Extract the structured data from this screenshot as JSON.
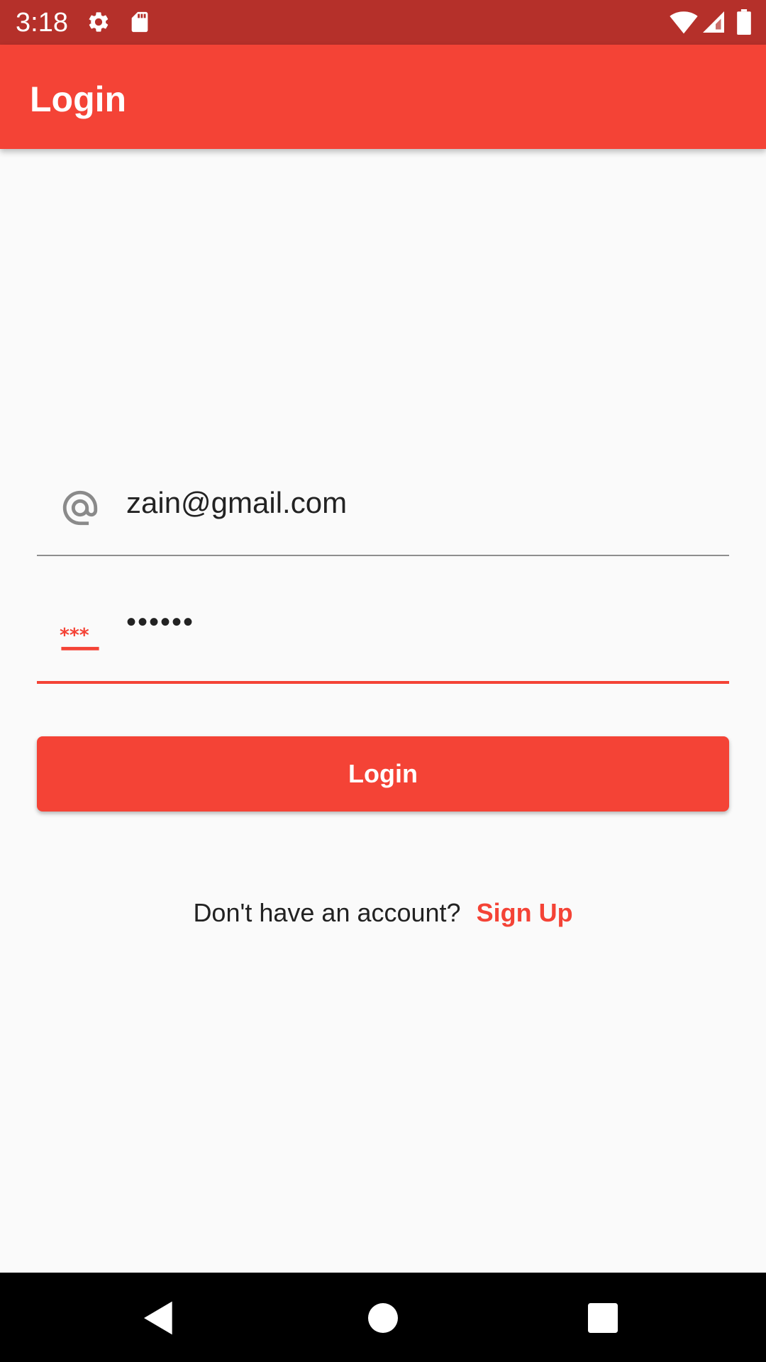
{
  "status_bar": {
    "time": "3:18",
    "icons": [
      "settings-icon",
      "sd-card-icon",
      "wifi-icon",
      "signal-icon",
      "battery-icon"
    ]
  },
  "app_bar": {
    "title": "Login",
    "color": "#f44336"
  },
  "form": {
    "email": {
      "icon": "at-sign-icon",
      "value": "zain@gmail.com"
    },
    "password": {
      "icon": "password-asterisks-icon",
      "value": "••••••"
    },
    "login_label": "Login"
  },
  "signup": {
    "prompt": "Don't have an account?",
    "link_label": "Sign Up"
  },
  "nav_bar": {
    "buttons": [
      "back-icon",
      "home-icon",
      "recents-icon"
    ]
  },
  "colors": {
    "accent": "#f44336",
    "status_bar": "#b5302a",
    "background": "#fafafa"
  }
}
